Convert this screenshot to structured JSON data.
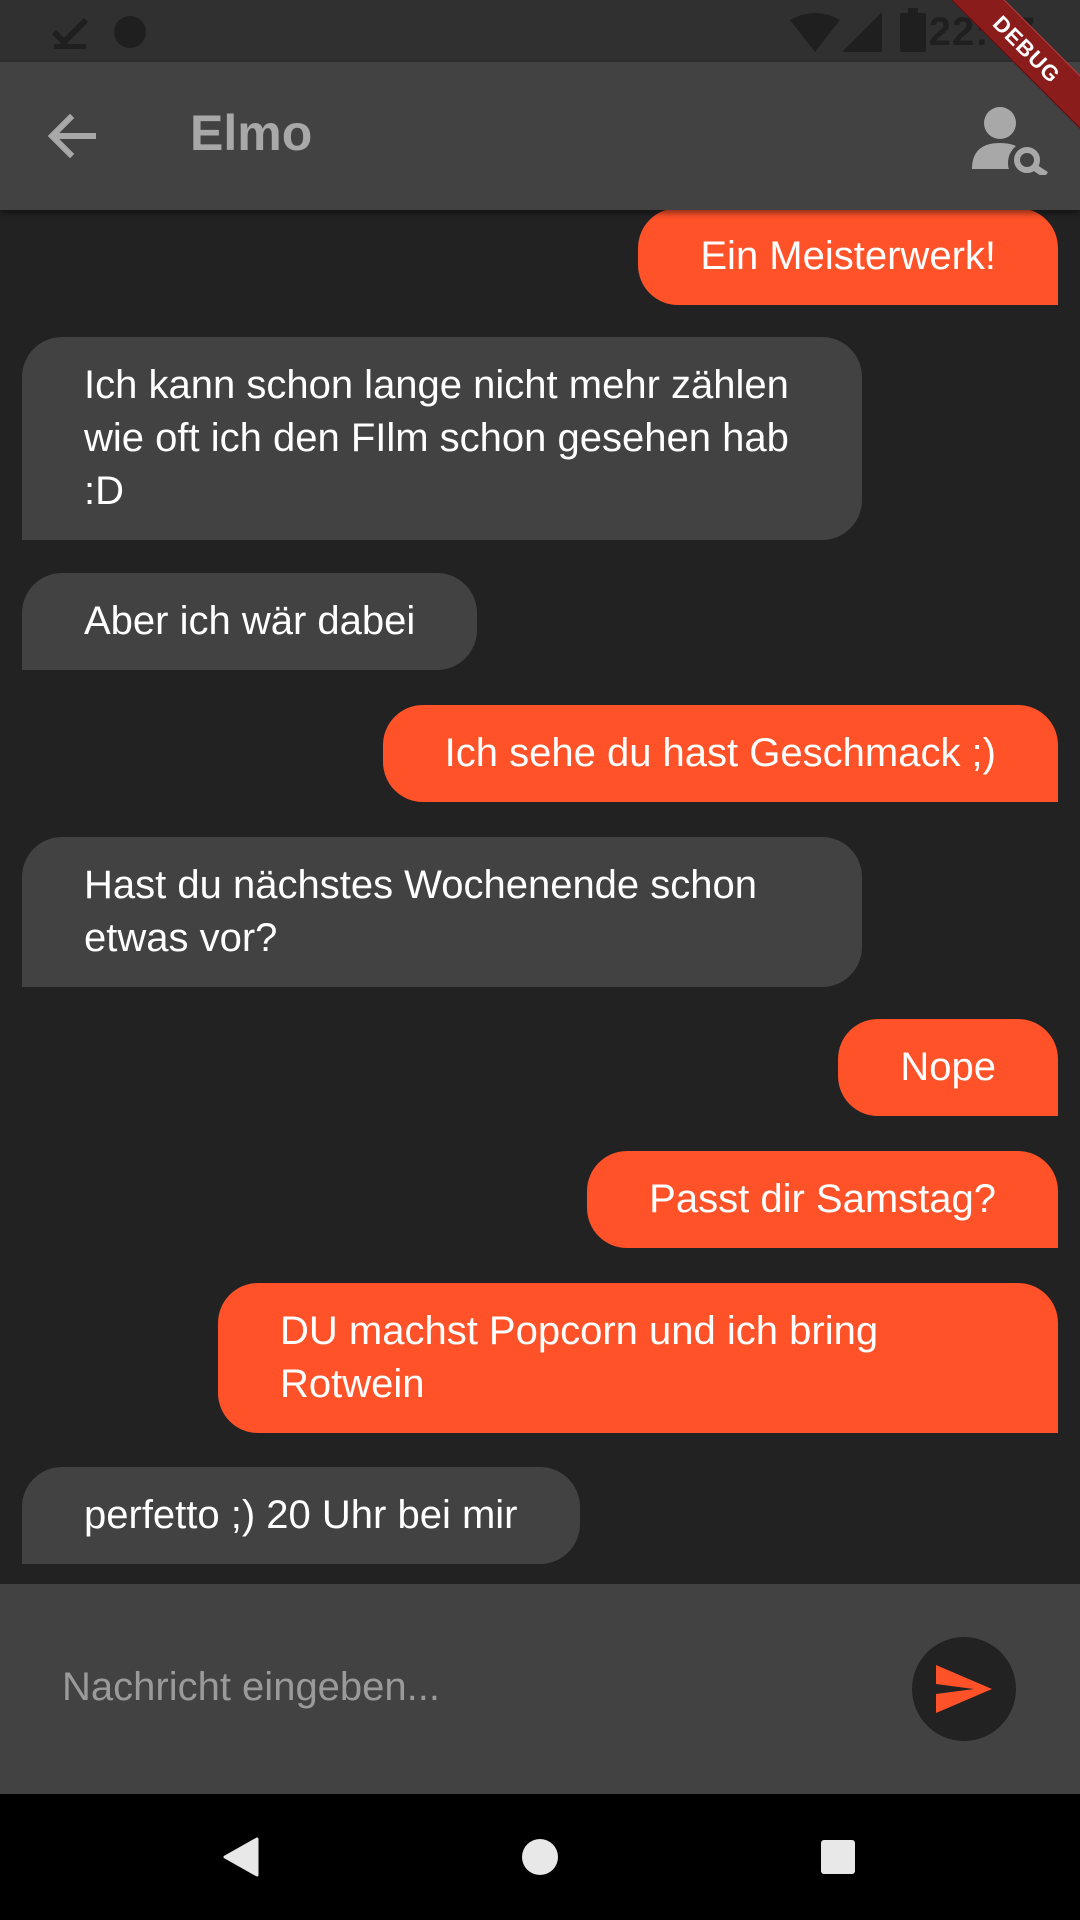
{
  "status_bar": {
    "time": "22:47",
    "icons": [
      "download-done-icon",
      "circle-notification-icon",
      "wifi-icon",
      "signal-icon",
      "battery-icon"
    ]
  },
  "debug_banner": "DEBUG",
  "app_bar": {
    "title": "Elmo",
    "back_icon": "arrow-back-icon",
    "action_icon": "person-search-icon"
  },
  "messages": [
    {
      "direction": "out",
      "text": "Ein Meisterwerk!"
    },
    {
      "direction": "in",
      "text": "Ich kann schon lange nicht mehr zählen wie oft ich den FIlm schon gesehen hab :D"
    },
    {
      "direction": "in",
      "text": "Aber ich wär dabei"
    },
    {
      "direction": "out",
      "text": "Ich sehe du hast Geschmack ;)"
    },
    {
      "direction": "in",
      "text": "Hast du nächstes Wochenende schon etwas vor?"
    },
    {
      "direction": "out",
      "text": "Nope"
    },
    {
      "direction": "out",
      "text": "Passt dir Samstag?"
    },
    {
      "direction": "out",
      "text": "DU machst Popcorn und ich bring Rotwein"
    },
    {
      "direction": "in",
      "text": "perfetto ;) 20 Uhr bei mir"
    }
  ],
  "composer": {
    "placeholder": "Nachricht eingeben...",
    "value": "",
    "send_icon": "send-icon"
  },
  "colors": {
    "accent": "#ff5228",
    "incoming_bubble": "#424242",
    "background": "#222222",
    "app_bar": "#424242"
  },
  "nav_bar": [
    "back-triangle-icon",
    "home-circle-icon",
    "recents-square-icon"
  ]
}
